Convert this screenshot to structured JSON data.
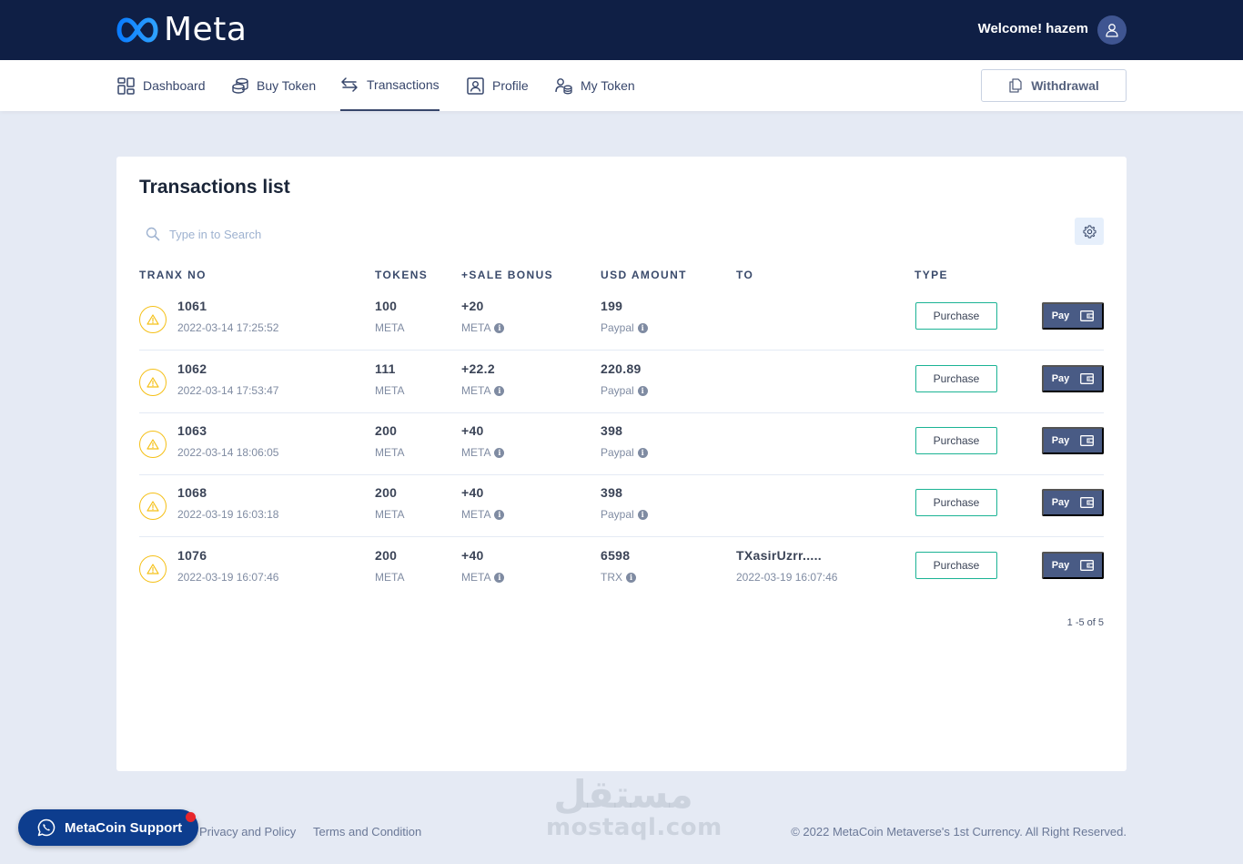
{
  "header": {
    "brand": "Meta",
    "welcome": "Welcome! hazem"
  },
  "nav": {
    "items": [
      {
        "label": "Dashboard",
        "icon": "grid-icon"
      },
      {
        "label": "Buy Token",
        "icon": "coins-icon"
      },
      {
        "label": "Transactions",
        "icon": "arrows-swap-icon",
        "active": true
      },
      {
        "label": "Profile",
        "icon": "user-card-icon"
      },
      {
        "label": "My Token",
        "icon": "user-coins-icon"
      }
    ],
    "withdraw_label": "Withdrawal"
  },
  "transactions": {
    "title": "Transactions list",
    "search_placeholder": "Type in to Search",
    "columns": {
      "tranx": "TRANX NO",
      "tokens": "TOKENS",
      "bonus": "+SALE BONUS",
      "usd": "USD AMOUNT",
      "to": "TO",
      "type": "TYPE"
    },
    "rows": [
      {
        "id": "1061",
        "date": "2022-03-14 17:25:52",
        "tokens": "100",
        "tokens_unit": "META",
        "bonus": "+20",
        "bonus_unit": "META",
        "usd": "199",
        "method": "Paypal",
        "to": "",
        "to_date": "",
        "type": "Purchase",
        "pay": "Pay"
      },
      {
        "id": "1062",
        "date": "2022-03-14 17:53:47",
        "tokens": "111",
        "tokens_unit": "META",
        "bonus": "+22.2",
        "bonus_unit": "META",
        "usd": "220.89",
        "method": "Paypal",
        "to": "",
        "to_date": "",
        "type": "Purchase",
        "pay": "Pay"
      },
      {
        "id": "1063",
        "date": "2022-03-14 18:06:05",
        "tokens": "200",
        "tokens_unit": "META",
        "bonus": "+40",
        "bonus_unit": "META",
        "usd": "398",
        "method": "Paypal",
        "to": "",
        "to_date": "",
        "type": "Purchase",
        "pay": "Pay"
      },
      {
        "id": "1068",
        "date": "2022-03-19 16:03:18",
        "tokens": "200",
        "tokens_unit": "META",
        "bonus": "+40",
        "bonus_unit": "META",
        "usd": "398",
        "method": "Paypal",
        "to": "",
        "to_date": "",
        "type": "Purchase",
        "pay": "Pay"
      },
      {
        "id": "1076",
        "date": "2022-03-19 16:07:46",
        "tokens": "200",
        "tokens_unit": "META",
        "bonus": "+40",
        "bonus_unit": "META",
        "usd": "6598",
        "method": "TRX",
        "to": "TXasirUzrr.....",
        "to_date": "2022-03-19 16:07:46",
        "type": "Purchase",
        "pay": "Pay"
      }
    ],
    "pagination": "1 -5 of 5"
  },
  "footer": {
    "privacy": "Privacy and Policy",
    "terms": "Terms and Condition",
    "copyright": "© 2022 MetaCoin Metaverse's 1st Currency. All Right Reserved.",
    "support": "MetaCoin Support"
  },
  "watermark": {
    "arabic": "مستقل",
    "latin": "mostaql.com"
  },
  "colors": {
    "header_bg": "#0f1f45",
    "page_bg": "#e5eaf4",
    "purchase_border": "#1bb394",
    "pay_bg": "#495b85",
    "warning": "#f5c017",
    "support_bg": "#0d3d8e"
  }
}
